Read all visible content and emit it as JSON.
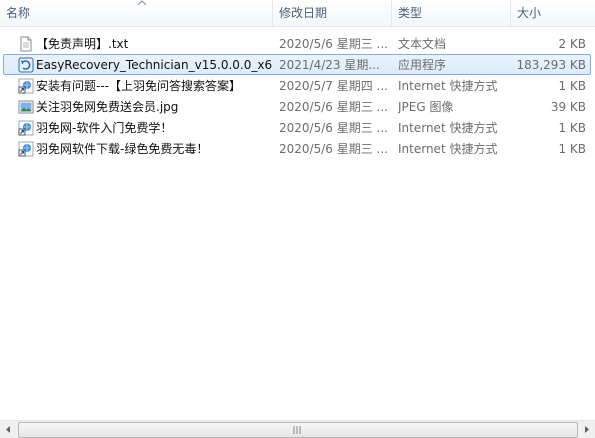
{
  "columns": {
    "name": "名称",
    "date": "修改日期",
    "type": "类型",
    "size": "大小"
  },
  "files": [
    {
      "name": "【免责声明】.txt",
      "date": "2020/5/6 星期三 ...",
      "type": "文本文档",
      "size": "2 KB",
      "icon": "text-file-icon"
    },
    {
      "name": "EasyRecovery_Technician_v15.0.0.0_x6...",
      "date": "2021/4/23 星期...",
      "type": "应用程序",
      "size": "183,293 KB",
      "icon": "application-icon",
      "selected": true
    },
    {
      "name": "安装有问题---【上羽免问答搜索答案】",
      "date": "2020/5/7 星期四 ...",
      "type": "Internet 快捷方式",
      "size": "1 KB",
      "icon": "internet-shortcut-icon"
    },
    {
      "name": "关注羽免网免费送会员.jpg",
      "date": "2020/5/6 星期三 ...",
      "type": "JPEG 图像",
      "size": "39 KB",
      "icon": "image-file-icon"
    },
    {
      "name": "羽免网-软件入门免费学！",
      "date": "2020/5/6 星期三 ...",
      "type": "Internet 快捷方式",
      "size": "1 KB",
      "icon": "internet-shortcut-icon"
    },
    {
      "name": "羽免网软件下载-绿色免费无毒！",
      "date": "2020/5/6 星期三 ...",
      "type": "Internet 快捷方式",
      "size": "1 KB",
      "icon": "internet-shortcut-icon"
    }
  ]
}
